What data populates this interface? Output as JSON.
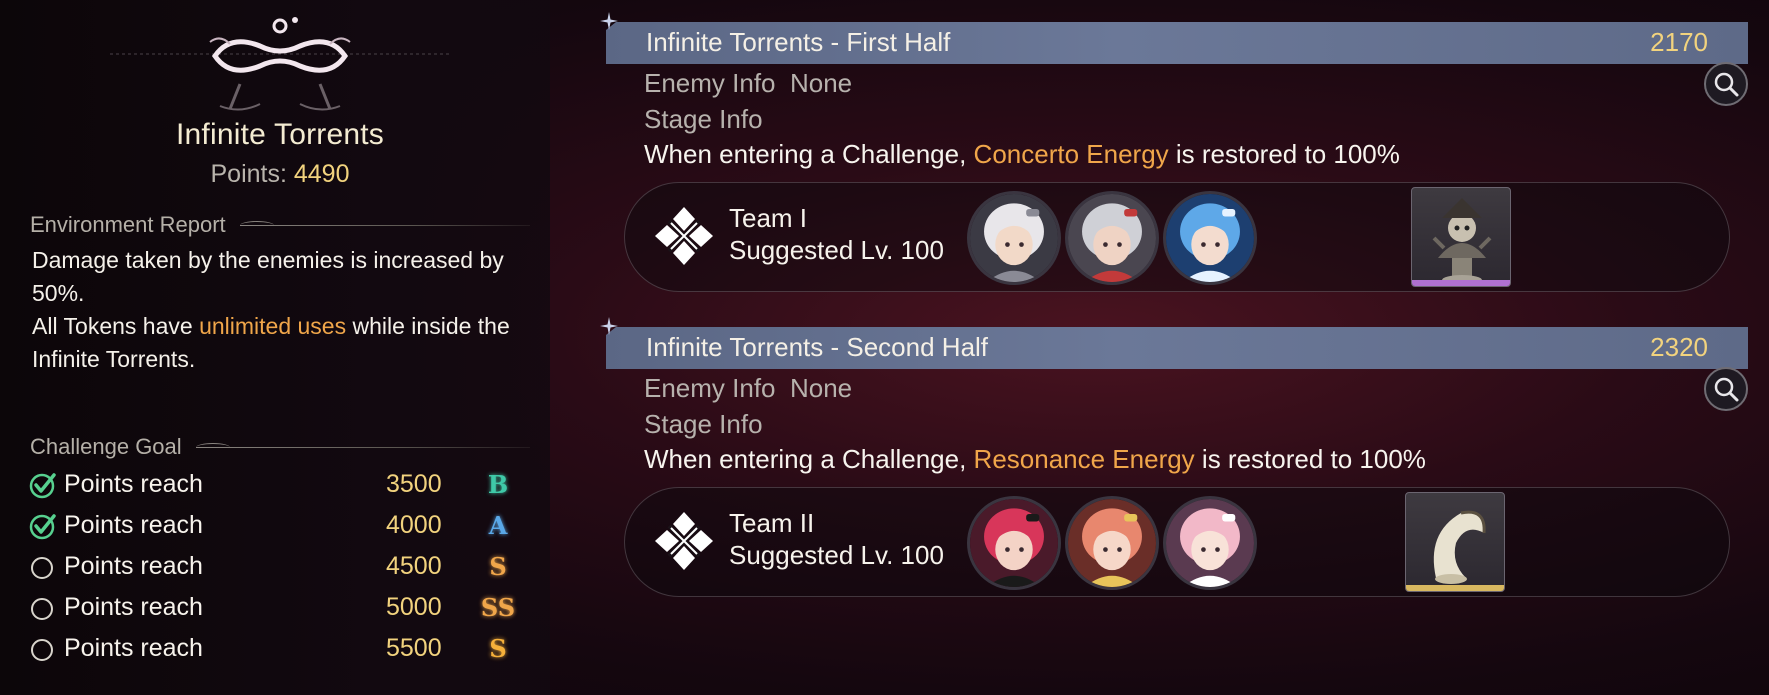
{
  "stage": {
    "title": "Infinite Torrents",
    "points_label": "Points:",
    "points_value": "4490"
  },
  "environment": {
    "heading": "Environment Report",
    "line1": "Damage taken by the enemies is increased by 50%.",
    "line2_pre": "All Tokens have ",
    "line2_highlight": "unlimited uses",
    "line2_post": " while inside the Infinite Torrents."
  },
  "challenge": {
    "heading": "Challenge Goal",
    "goals": [
      {
        "label": "Points reach",
        "value": "3500",
        "rank": "B",
        "done": true,
        "rank_color": "#3fc9a8"
      },
      {
        "label": "Points reach",
        "value": "4000",
        "rank": "A",
        "done": true,
        "rank_color": "#5aa8e8"
      },
      {
        "label": "Points reach",
        "value": "4500",
        "rank": "S",
        "done": false,
        "rank_color": "#f0a64a"
      },
      {
        "label": "Points reach",
        "value": "5000",
        "rank": "SS",
        "done": false,
        "rank_color": "#f0a64a"
      },
      {
        "label": "Points reach",
        "value": "5500",
        "rank": "S",
        "done": false,
        "rank_color": "#f5b03a"
      }
    ]
  },
  "halves": [
    {
      "title": "Infinite Torrents - First Half",
      "score": "2170",
      "enemy_info_label": "Enemy Info",
      "enemy_info_value": "None",
      "stage_info_label": "Stage Info",
      "desc_pre": "When entering a Challenge, ",
      "desc_highlight": "Concerto Energy",
      "desc_post": " is restored to 100%",
      "team_name": "Team I",
      "team_level": "Suggested Lv. 100",
      "echo_accent": "#b070d0"
    },
    {
      "title": "Infinite Torrents - Second Half",
      "score": "2320",
      "enemy_info_label": "Enemy Info",
      "enemy_info_value": "None",
      "stage_info_label": "Stage Info",
      "desc_pre": "When entering a Challenge, ",
      "desc_highlight": "Resonance Energy",
      "desc_post": " is restored to 100%",
      "team_name": "Team II",
      "team_level": "Suggested Lv. 100",
      "echo_accent": "#d8b860"
    }
  ],
  "colors": {
    "gold": "#f2d37e",
    "highlight_orange": "#f0a64a",
    "header_bar": "#6b7898"
  },
  "icons": {
    "stage_emblem": "infinity-anchor-emblem",
    "search": "search-icon",
    "check": "check-circle-icon",
    "empty": "empty-circle-icon",
    "team": "crossed-swords-team-icon"
  }
}
